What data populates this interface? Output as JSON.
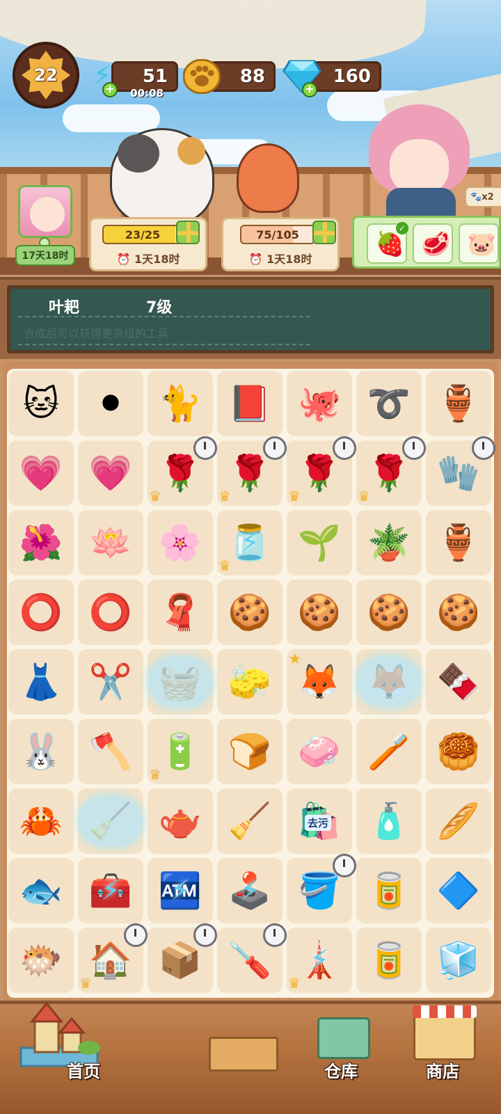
{
  "hud": {
    "level": "22",
    "energy": {
      "value": "51",
      "timer": "00:08",
      "icon": "lightning-icon"
    },
    "paws": {
      "value": "88",
      "icon": "paw-coin-icon"
    },
    "gems": {
      "value": "160",
      "icon": "diamond-icon"
    }
  },
  "events": {
    "avatar_timer": "17天18时",
    "task1": {
      "progress": "23/25",
      "time": "1天18时",
      "fill": 0.92
    },
    "task2": {
      "progress": "75/105",
      "time": "1天18时",
      "fill": 0.71
    },
    "paw_badge": "x2"
  },
  "info_board": {
    "item_name": "叶耙",
    "item_level": "7级",
    "description": "合成后可以获得更高级的工具"
  },
  "grid": [
    [
      {
        "name": "raccoon-keychain",
        "g": "🐱"
      },
      {
        "name": "go-board",
        "g": "⚫"
      },
      {
        "name": "cat-keychain",
        "g": "🐈"
      },
      {
        "name": "magic-book",
        "g": "📕"
      },
      {
        "name": "octopus-keychain",
        "g": "🐙"
      },
      {
        "name": "leather-strap",
        "g": "➰"
      },
      {
        "name": "cobweb-pot",
        "g": "🏺"
      }
    ],
    [
      {
        "name": "rose-heart",
        "g": "💗"
      },
      {
        "name": "rose-heart",
        "g": "💗"
      },
      {
        "name": "rose-pot",
        "g": "🌹",
        "crown": true,
        "timer": true
      },
      {
        "name": "rose-pot",
        "g": "🌹",
        "crown": true,
        "timer": true
      },
      {
        "name": "rose-pot",
        "g": "🌹",
        "crown": true,
        "timer": true
      },
      {
        "name": "rose-pot",
        "g": "🌹",
        "crown": true,
        "timer": true
      },
      {
        "name": "garden-glove",
        "g": "🧤",
        "timer": true
      }
    ],
    [
      {
        "name": "rose-petals",
        "g": "🌺"
      },
      {
        "name": "petal",
        "g": "🪷"
      },
      {
        "name": "petal",
        "g": "🌸"
      },
      {
        "name": "petal-jar",
        "g": "🫙",
        "crown": true,
        "bolt": true
      },
      {
        "name": "sprout-seed",
        "g": "🌱"
      },
      {
        "name": "plant-pot",
        "g": "🪴"
      },
      {
        "name": "green-vase",
        "g": "🏺"
      }
    ],
    [
      {
        "name": "embroidery-hoop",
        "g": "⭕"
      },
      {
        "name": "hoop",
        "g": "⭕"
      },
      {
        "name": "cat-cloth",
        "g": "🧣"
      },
      {
        "name": "paw-cookie",
        "g": "🍪"
      },
      {
        "name": "paw-cookies",
        "g": "🍪"
      },
      {
        "name": "paw-cookies",
        "g": "🍪"
      },
      {
        "name": "paw-cookies",
        "g": "🍪"
      }
    ],
    [
      {
        "name": "apron-ruffle",
        "g": "👗"
      },
      {
        "name": "pruning-shears",
        "g": "✂️"
      },
      {
        "name": "cloud-bubble-item",
        "g": "🧺",
        "bubble": true
      },
      {
        "name": "sponge",
        "g": "🧽"
      },
      {
        "name": "fox-sticker",
        "g": "🦊",
        "star": true
      },
      {
        "name": "fox-stickers",
        "g": "🦊",
        "bubble": true
      },
      {
        "name": "chocolate-bar",
        "g": "🍫"
      }
    ],
    [
      {
        "name": "bunny-apron",
        "g": "🐰"
      },
      {
        "name": "hatchet",
        "g": "🪓"
      },
      {
        "name": "battery",
        "g": "🔋",
        "crown": true
      },
      {
        "name": "bread-ball",
        "g": "🍞"
      },
      {
        "name": "soap-bar",
        "g": "🧼"
      },
      {
        "name": "toothpaste",
        "g": "🪥"
      },
      {
        "name": "cookie-stack",
        "g": "🥮"
      }
    ],
    [
      {
        "name": "crab",
        "g": "🦀"
      },
      {
        "name": "leaf-rake-bubble",
        "g": "🧹",
        "bubble": true
      },
      {
        "name": "teapot",
        "g": "🫖"
      },
      {
        "name": "scraper",
        "g": "🧹"
      },
      {
        "name": "detergent-bag",
        "g": "🛍️",
        "text": "去污"
      },
      {
        "name": "detergent-bottle",
        "g": "🧴"
      },
      {
        "name": "egg-rolls",
        "g": "🥖"
      }
    ],
    [
      {
        "name": "fish",
        "g": "🐟"
      },
      {
        "name": "cleaning-machine",
        "g": "🧰",
        "bolt": true
      },
      {
        "name": "vending-machine",
        "g": "🏧",
        "bolt": true
      },
      {
        "name": "arcade-machine",
        "g": "🕹️",
        "bolt": true
      },
      {
        "name": "wash-bucket",
        "g": "🪣",
        "timer": true
      },
      {
        "name": "paint-can",
        "g": "🥫"
      },
      {
        "name": "glass-tray",
        "g": "🔷"
      }
    ],
    [
      {
        "name": "pufferfish",
        "g": "🐡"
      },
      {
        "name": "cat-house",
        "g": "🏠",
        "crown": true,
        "timer": true
      },
      {
        "name": "crate",
        "g": "📦",
        "timer": true
      },
      {
        "name": "screwdriver",
        "g": "🪛",
        "timer": true
      },
      {
        "name": "charging-pod",
        "g": "🗼",
        "crown": true,
        "bolt": true
      },
      {
        "name": "paint-cans",
        "g": "🥫"
      },
      {
        "name": "glass-box",
        "g": "🧊"
      }
    ]
  ],
  "nav": {
    "home": "首页",
    "warehouse": "仓库",
    "shop": "商店"
  }
}
